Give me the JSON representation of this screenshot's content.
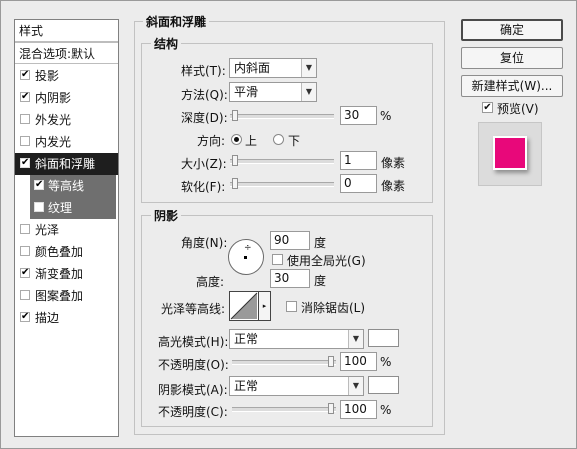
{
  "sidebar": {
    "header": "样式",
    "blend": "混合选项:默认",
    "items": [
      {
        "label": "投影",
        "checked": true
      },
      {
        "label": "内阴影",
        "checked": true
      },
      {
        "label": "外发光",
        "checked": false
      },
      {
        "label": "内发光",
        "checked": false
      },
      {
        "label": "斜面和浮雕",
        "checked": true
      },
      {
        "label": "等高线",
        "checked": true
      },
      {
        "label": "纹理",
        "checked": false
      },
      {
        "label": "光泽",
        "checked": false
      },
      {
        "label": "颜色叠加",
        "checked": false
      },
      {
        "label": "渐变叠加",
        "checked": true
      },
      {
        "label": "图案叠加",
        "checked": false
      },
      {
        "label": "描边",
        "checked": true
      }
    ],
    "check_glyph": "✔"
  },
  "bevel": {
    "title": "斜面和浮雕",
    "structure": {
      "title": "结构",
      "style_label": "样式(T):",
      "style_value": "内斜面",
      "technique_label": "方法(Q):",
      "technique_value": "平滑",
      "depth_label": "深度(D):",
      "depth_value": "30",
      "depth_unit": "%",
      "depth_fraction": 0.03,
      "direction_label": "方向:",
      "direction_up": "上",
      "direction_down": "下",
      "size_label": "大小(Z):",
      "size_value": "1",
      "size_unit": "像素",
      "soften_label": "软化(F):",
      "soften_value": "0",
      "soften_unit": "像素"
    },
    "shading": {
      "title": "阴影",
      "angle_label": "角度(N):",
      "angle_value": "90",
      "angle_unit": "度",
      "global_light_label": "使用全局光(G)",
      "altitude_label": "高度:",
      "altitude_value": "30",
      "altitude_unit": "度",
      "gloss_contour_label": "光泽等高线:",
      "anti_alias_label": "消除锯齿(L)",
      "highlight_mode_label": "高光模式(H):",
      "highlight_mode_value": "正常",
      "highlight_opacity_label": "不透明度(O):",
      "highlight_opacity_value": "100",
      "highlight_opacity_unit": "%",
      "shadow_mode_label": "阴影模式(A):",
      "shadow_mode_value": "正常",
      "shadow_opacity_label": "不透明度(C):",
      "shadow_opacity_value": "100",
      "shadow_opacity_unit": "%"
    }
  },
  "buttons": {
    "ok": "确定",
    "reset": "复位",
    "new_style": "新建样式(W)...",
    "preview_label": "预览(V)"
  },
  "colors": {
    "preview_fill": "#e8087a",
    "highlight_color": "#ffffff",
    "shadow_color": "#ffffff"
  },
  "glyphs": {
    "dropdown": "▼",
    "slider_arrow": "▸"
  }
}
